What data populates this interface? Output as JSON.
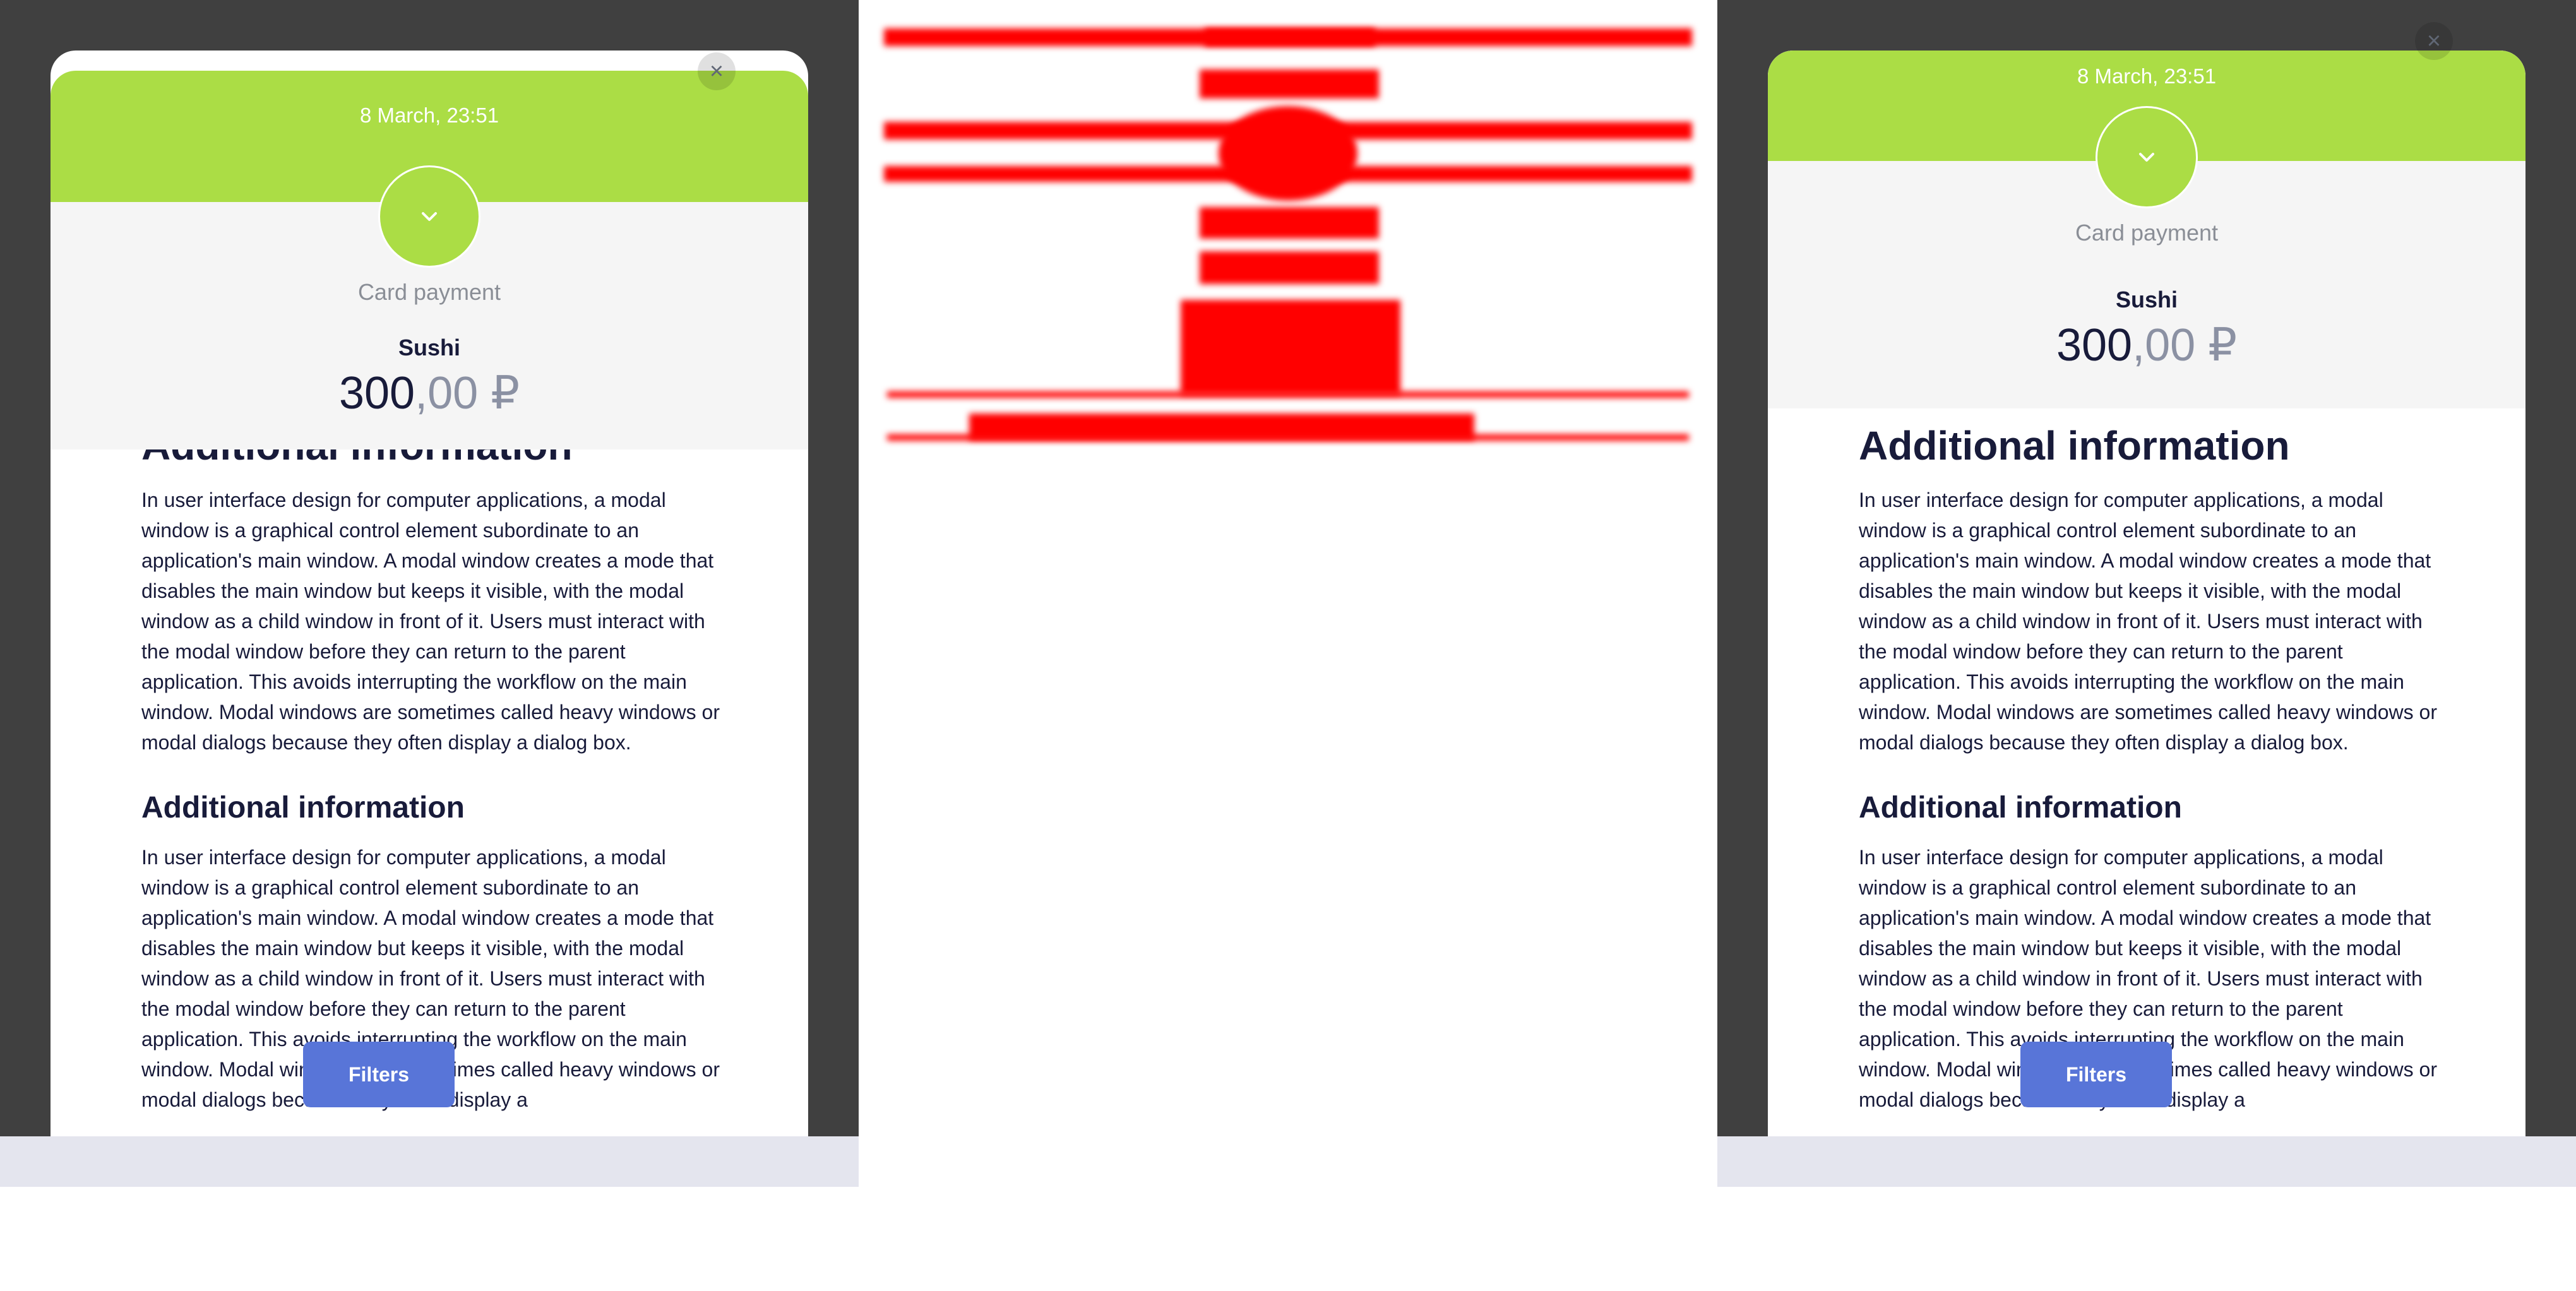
{
  "left_view": {
    "date": "8 March, 23:51",
    "payment_type": "Card payment",
    "merchant": "Sushi",
    "amount_main": "300",
    "amount_fraction": ",00 ₽",
    "section_title": "Additional information",
    "paragraph": "In user interface design for computer applications, a modal window is a graphical control element subordinate to an application's main window. A modal window creates a mode that disables the main window but keeps it visible, with the modal window as a child window in front of it. Users must interact with the modal window before they can return to the parent application. This avoids interrupting the workflow on the main window. Modal windows are sometimes called heavy windows or modal dialogs because they often display a dialog box.",
    "section_title_2": "Additional information",
    "paragraph_2": "In user interface design for computer applications, a modal window is a graphical control element subordinate to an application's main window. A modal window creates a mode that disables the main window but keeps it visible, with the modal window as a child window in front of it. Users must interact with the modal window before they can return to the parent application. This avoids interrupting the workflow on the main window. Modal windows are sometimes called heavy windows or modal dialogs because they often display a",
    "filters_label": "Filters",
    "close_label": "×"
  },
  "right_view": {
    "date": "8 March, 23:51",
    "payment_type": "Card payment",
    "merchant": "Sushi",
    "amount_main": "300",
    "amount_fraction": ",00 ₽",
    "section_title": "Additional information",
    "paragraph": "In user interface design for computer applications, a modal window is a graphical control element subordinate to an application's main window. A modal window creates a mode that disables the main window but keeps it visible, with the modal window as a child window in front of it. Users must interact with the modal window before they can return to the parent application. This avoids interrupting the workflow on the main window. Modal windows are sometimes called heavy windows or modal dialogs because they often display a dialog box.",
    "section_title_2": "Additional information",
    "paragraph_2": "In user interface design for computer applications, a modal window is a graphical control element subordinate to an application's main window. A modal window creates a mode that disables the main window but keeps it visible, with the modal window as a child window in front of it. Users must interact with the modal window before they can return to the parent application. This avoids interrupting the workflow on the main window. Modal windows are sometimes called heavy windows or modal dialogs because they often display a",
    "filters_label": "Filters",
    "close_label": "×"
  },
  "colors": {
    "backdrop": "#404040",
    "accent_green": "#abdd45",
    "header_gray": "#f5f5f5",
    "button_blue": "#5875d8",
    "text_dark": "#181b3a",
    "text_muted": "#8a8e96",
    "diff_red": "#ff0000",
    "bottom_strip": "#e4e5ee"
  },
  "icons": {
    "close": "close-icon",
    "status": "chevron-down-icon"
  }
}
